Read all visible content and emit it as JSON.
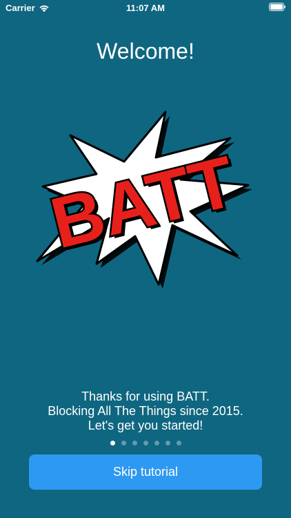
{
  "status_bar": {
    "carrier": "Carrier",
    "time": "11:07 AM",
    "wifi_icon": "wifi-icon",
    "battery_icon": "battery-icon"
  },
  "title": "Welcome!",
  "logo": {
    "text": "BATT",
    "colors": {
      "burst": "#ffffff",
      "letters": "#e8201c",
      "outline": "#000000"
    }
  },
  "message": {
    "line1": "Thanks for using BATT.",
    "line2": "Blocking All The Things since 2015.",
    "line3": "Let's get you started!"
  },
  "page_indicator": {
    "current_page": 1,
    "total_pages": 7
  },
  "skip_button": {
    "label": "Skip tutorial"
  },
  "colors": {
    "background": "#0f6680",
    "button": "#2e99f0"
  }
}
